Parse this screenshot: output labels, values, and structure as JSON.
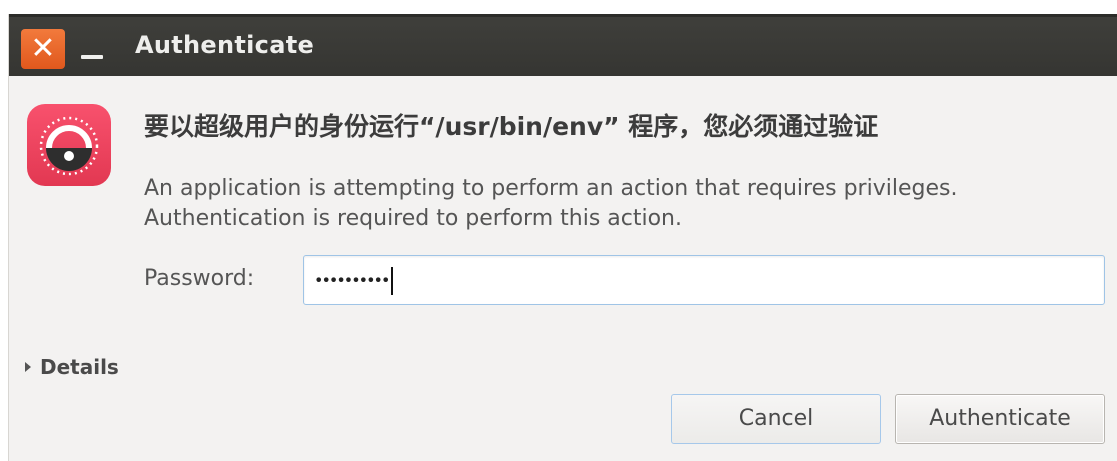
{
  "window": {
    "title": "Authenticate",
    "close_glyph": "✕",
    "minimize_glyph": ""
  },
  "dialog": {
    "icon": "lock-icon",
    "heading": "要以超级用户的身份运行“/usr/bin/env” 程序，您必须通过验证",
    "description_line1": "An application is attempting to perform an action that requires privileges.",
    "description_line2": "Authentication is required to perform this action.",
    "password_label": "Password:",
    "password_value": "••••••••••",
    "details_label": "Details",
    "cancel_label": "Cancel",
    "authenticate_label": "Authenticate"
  },
  "colors": {
    "titlebar": "#3c3b37",
    "close_button": "#e8622a",
    "icon_background": "#ef4560",
    "dialog_background": "#f3f2f1",
    "input_focus_border": "#9fc4e6"
  }
}
